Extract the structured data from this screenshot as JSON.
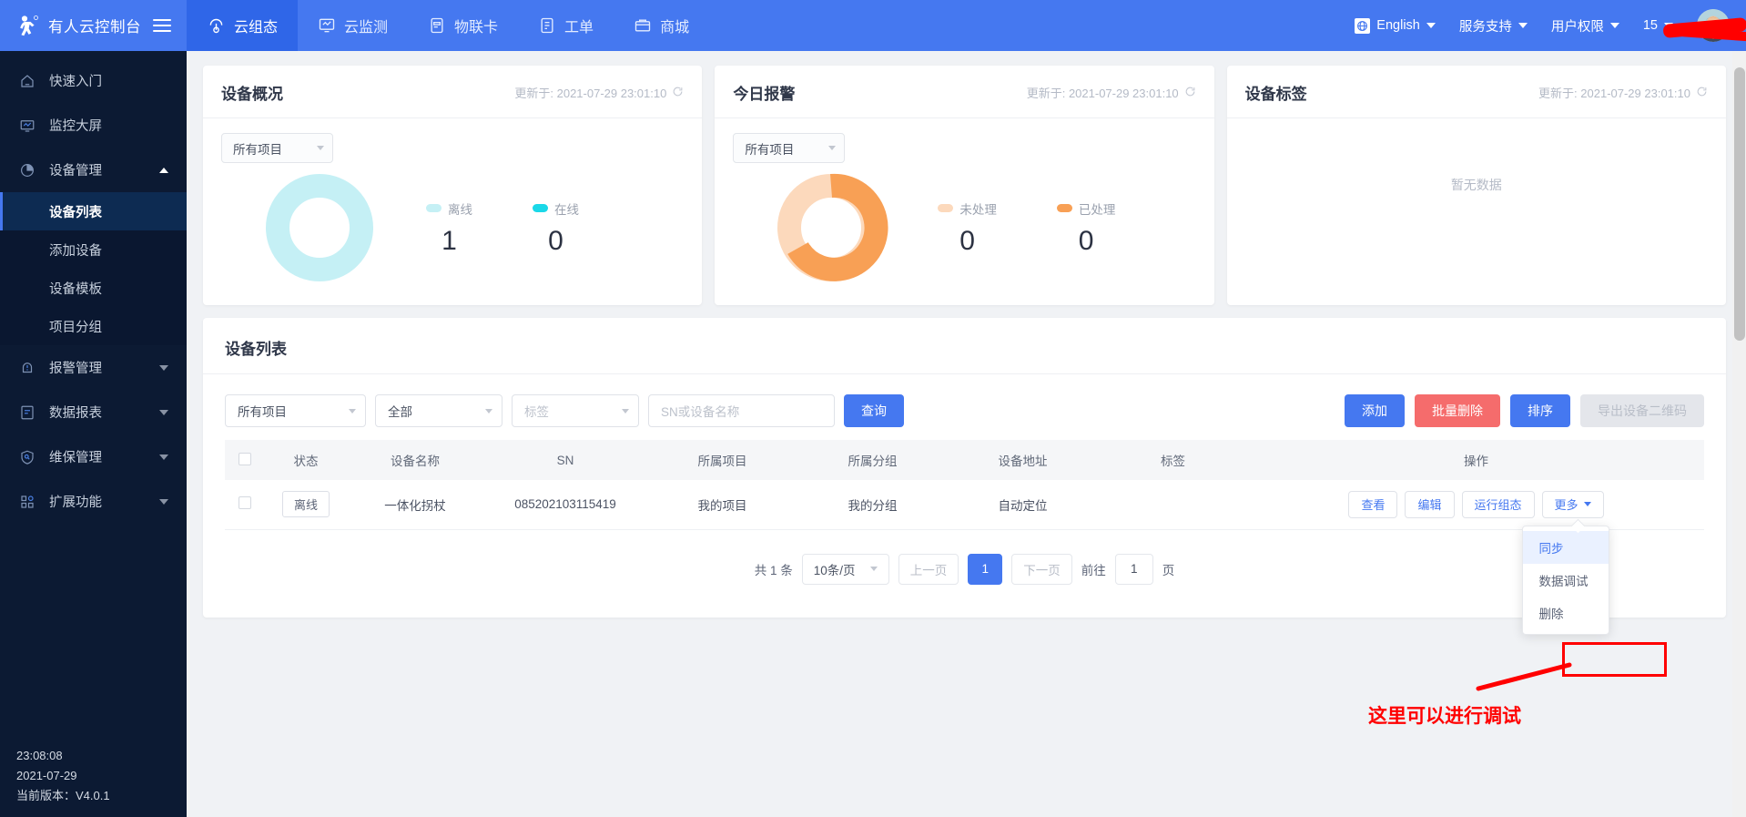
{
  "header": {
    "brand_name": "有人云控制台",
    "nav": [
      {
        "label": "云组态",
        "icon": "cloud-icon",
        "active": true
      },
      {
        "label": "云监测",
        "icon": "monitor-icon",
        "active": false
      },
      {
        "label": "物联卡",
        "icon": "sim-card-icon",
        "active": false
      },
      {
        "label": "工单",
        "icon": "ticket-icon",
        "active": false
      },
      {
        "label": "商城",
        "icon": "shop-icon",
        "active": false
      }
    ],
    "language": "English",
    "support": "服务支持",
    "permissions": "用户权限",
    "account": "15",
    "accent_color": "#4578f0"
  },
  "sidebar": {
    "items": [
      {
        "label": "快速入门",
        "icon": "home-icon",
        "expandable": false
      },
      {
        "label": "监控大屏",
        "icon": "screen-icon",
        "expandable": false
      },
      {
        "label": "设备管理",
        "icon": "pie-chart-icon",
        "expandable": true,
        "expanded": true
      },
      {
        "label": "报警管理",
        "icon": "bell-alert-icon",
        "expandable": true,
        "expanded": false
      },
      {
        "label": "数据报表",
        "icon": "report-icon",
        "expandable": true,
        "expanded": false
      },
      {
        "label": "维保管理",
        "icon": "shield-wrench-icon",
        "expandable": true,
        "expanded": false
      },
      {
        "label": "扩展功能",
        "icon": "grid-plus-icon",
        "expandable": true,
        "expanded": false
      }
    ],
    "submenu": [
      {
        "label": "设备列表",
        "active": true
      },
      {
        "label": "添加设备",
        "active": false
      },
      {
        "label": "设备模板",
        "active": false
      },
      {
        "label": "项目分组",
        "active": false
      }
    ],
    "footer": {
      "time": "23:08:08",
      "date": "2021-07-29",
      "version": "当前版本：V4.0.1"
    }
  },
  "cards": [
    {
      "title": "设备概况",
      "updated_label": "更新于: 2021-07-29 23:01:10",
      "filter": "所有项目",
      "has_chart": true,
      "empty_text": ""
    },
    {
      "title": "今日报警",
      "updated_label": "更新于: 2021-07-29 23:01:10",
      "filter": "所有项目",
      "has_chart": true,
      "empty_text": ""
    },
    {
      "title": "设备标签",
      "updated_label": "更新于: 2021-07-29 23:01:10",
      "filter": "",
      "has_chart": false,
      "empty_text": "暂无数据"
    }
  ],
  "chart_data": [
    {
      "type": "pie",
      "title": "设备概况",
      "legend_position": "right",
      "labels": [
        "离线",
        "在线"
      ],
      "values": [
        1,
        0
      ],
      "colors": [
        "#c5f0f5",
        "#1ad8e8"
      ]
    },
    {
      "type": "pie",
      "title": "今日报警",
      "legend_position": "right",
      "labels": [
        "未处理",
        "已处理"
      ],
      "values": [
        0,
        0
      ],
      "colors": [
        "#fcd9bc",
        "#f8a055"
      ]
    }
  ],
  "device_panel": {
    "title": "设备列表",
    "filters": {
      "project": "所有项目",
      "status": "全部",
      "tag_placeholder": "标签",
      "search_placeholder": "SN或设备名称",
      "search_button": "查询"
    },
    "actions": [
      {
        "label": "添加",
        "style": "primary"
      },
      {
        "label": "批量删除",
        "style": "danger"
      },
      {
        "label": "排序",
        "style": "primary"
      },
      {
        "label": "导出设备二维码",
        "style": "disabled"
      }
    ],
    "columns": [
      "状态",
      "设备名称",
      "SN",
      "所属项目",
      "所属分组",
      "设备地址",
      "标签",
      "操作"
    ],
    "rows": [
      {
        "status": "离线",
        "name": "一体化拐杖",
        "sn": "085202103115419",
        "project": "我的项目",
        "group": "我的分组",
        "address": "自动定位",
        "tag": "",
        "row_actions": [
          "查看",
          "编辑",
          "运行组态"
        ],
        "more_label": "更多"
      }
    ],
    "dropdown_menu": [
      {
        "label": "同步",
        "highlighted": true
      },
      {
        "label": "数据调试",
        "highlighted": false
      },
      {
        "label": "删除",
        "highlighted": false
      }
    ],
    "pagination": {
      "total_label": "共 1 条",
      "page_size": "10条/页",
      "prev": "上一页",
      "current": "1",
      "next": "下一页",
      "goto_label": "前往",
      "goto_value": "1",
      "page_unit": "页"
    }
  },
  "annotation": {
    "text": "这里可以进行调试",
    "color": "#ff0000"
  }
}
